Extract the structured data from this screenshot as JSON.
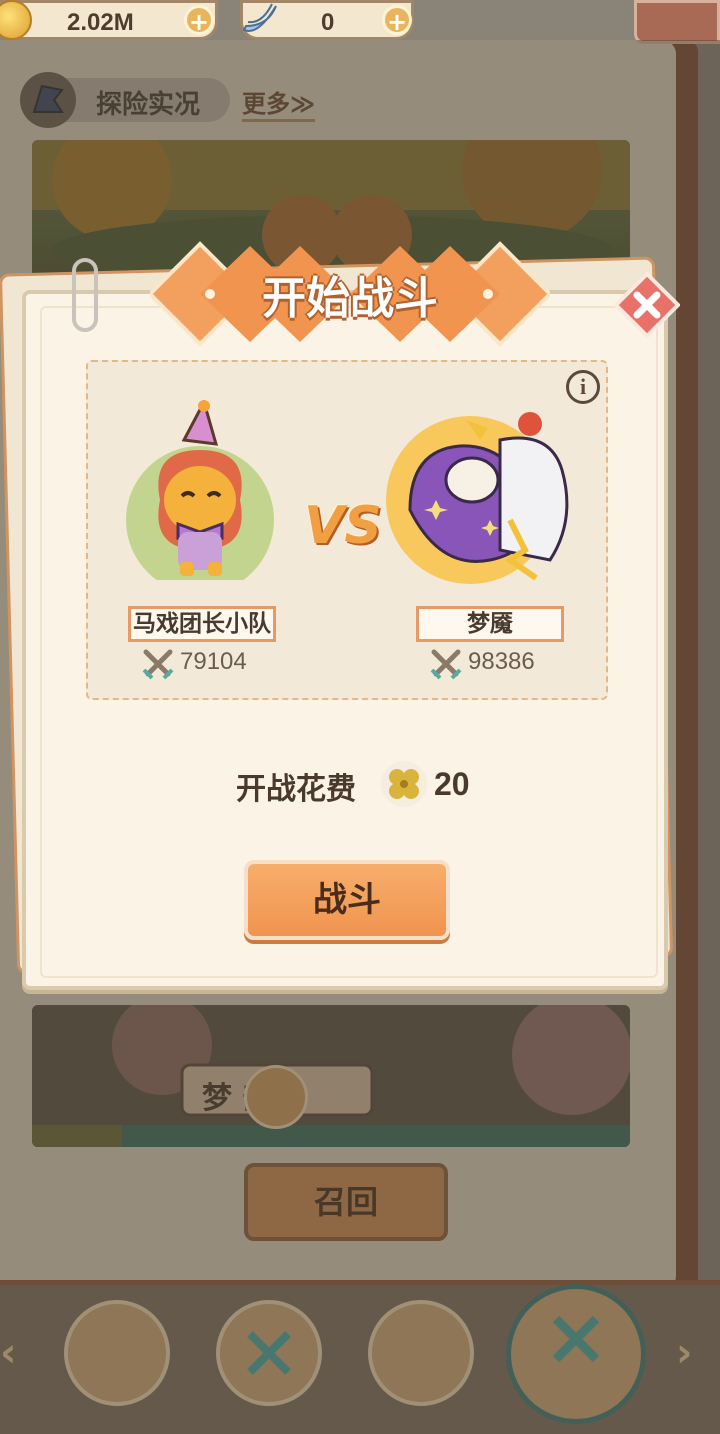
{
  "resources": {
    "gold": "2.02M",
    "bananas": "0"
  },
  "header": {
    "title": "探险实况",
    "more": "更多≫"
  },
  "scene2_sign": "梦  部",
  "recall_label": "召回",
  "modal": {
    "title": "开始战斗",
    "player": {
      "name": "马戏团长小队",
      "power": "79104"
    },
    "enemy": {
      "name": "梦魇",
      "power": "98386"
    },
    "vs_text": "VS",
    "cost_label": "开战花费",
    "cost_value": "20",
    "fight_label": "战斗",
    "info_label": "i"
  },
  "icons": {
    "coin": "gold-coin-icon",
    "banana": "banana-icon",
    "plus": "plus-icon",
    "close": "close-icon",
    "info": "info-icon",
    "sword": "crossed-swords-icon",
    "clover": "clover-icon",
    "flag": "flag-icon"
  },
  "colors": {
    "accent_orange": "#f09450",
    "name_border": "#e79a68",
    "team_selected_ring": "#3f7c76"
  }
}
